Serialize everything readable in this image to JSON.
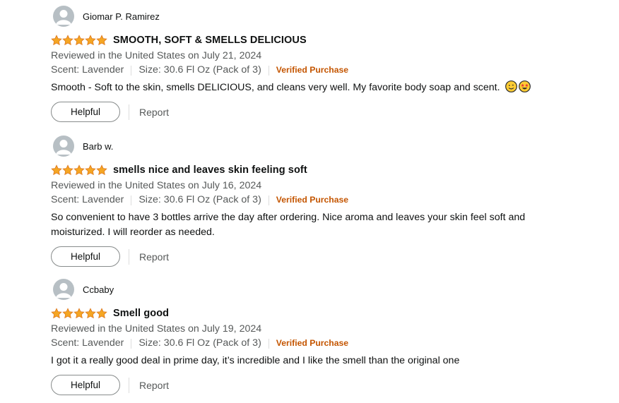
{
  "reviews": [
    {
      "name": "Giomar P. Ramirez",
      "rating": 5,
      "title": "SMOOTH, SOFT & SMELLS DELICIOUS",
      "date": "Reviewed in the United States on July 21, 2024",
      "scent": "Scent: Lavender",
      "size": "Size: 30.6 Fl Oz (Pack of 3)",
      "verified": "Verified Purchase",
      "body": "Smooth - Soft to the skin, smells DELICIOUS, and cleans very well. My favorite body soap and scent.",
      "emojis": [
        "smiling-face-icon",
        "star-struck-face-icon"
      ],
      "helpful_label": "Helpful",
      "report_label": "Report"
    },
    {
      "name": "Barb w.",
      "rating": 5,
      "title": "smells nice and leaves skin feeling soft",
      "date": "Reviewed in the United States on July 16, 2024",
      "scent": "Scent: Lavender",
      "size": "Size: 30.6 Fl Oz (Pack of 3)",
      "verified": "Verified Purchase",
      "body": "So convenient to have 3 bottles arrive the day after ordering. Nice aroma and leaves your skin feel soft and moisturized. I will reorder as needed.",
      "helpful_label": "Helpful",
      "report_label": "Report"
    },
    {
      "name": "Ccbaby",
      "rating": 5,
      "title": "Smell good",
      "date": "Reviewed in the United States on July 19, 2024",
      "scent": "Scent: Lavender",
      "size": "Size: 30.6 Fl Oz (Pack of 3)",
      "verified": "Verified Purchase",
      "body": "I got it a really good deal in prime day, it’s incredible and I like the smell than the original one",
      "helpful_label": "Helpful",
      "report_label": "Report"
    }
  ],
  "colors": {
    "star": "#f5a623",
    "verified": "#c45500",
    "meta": "#565959"
  }
}
